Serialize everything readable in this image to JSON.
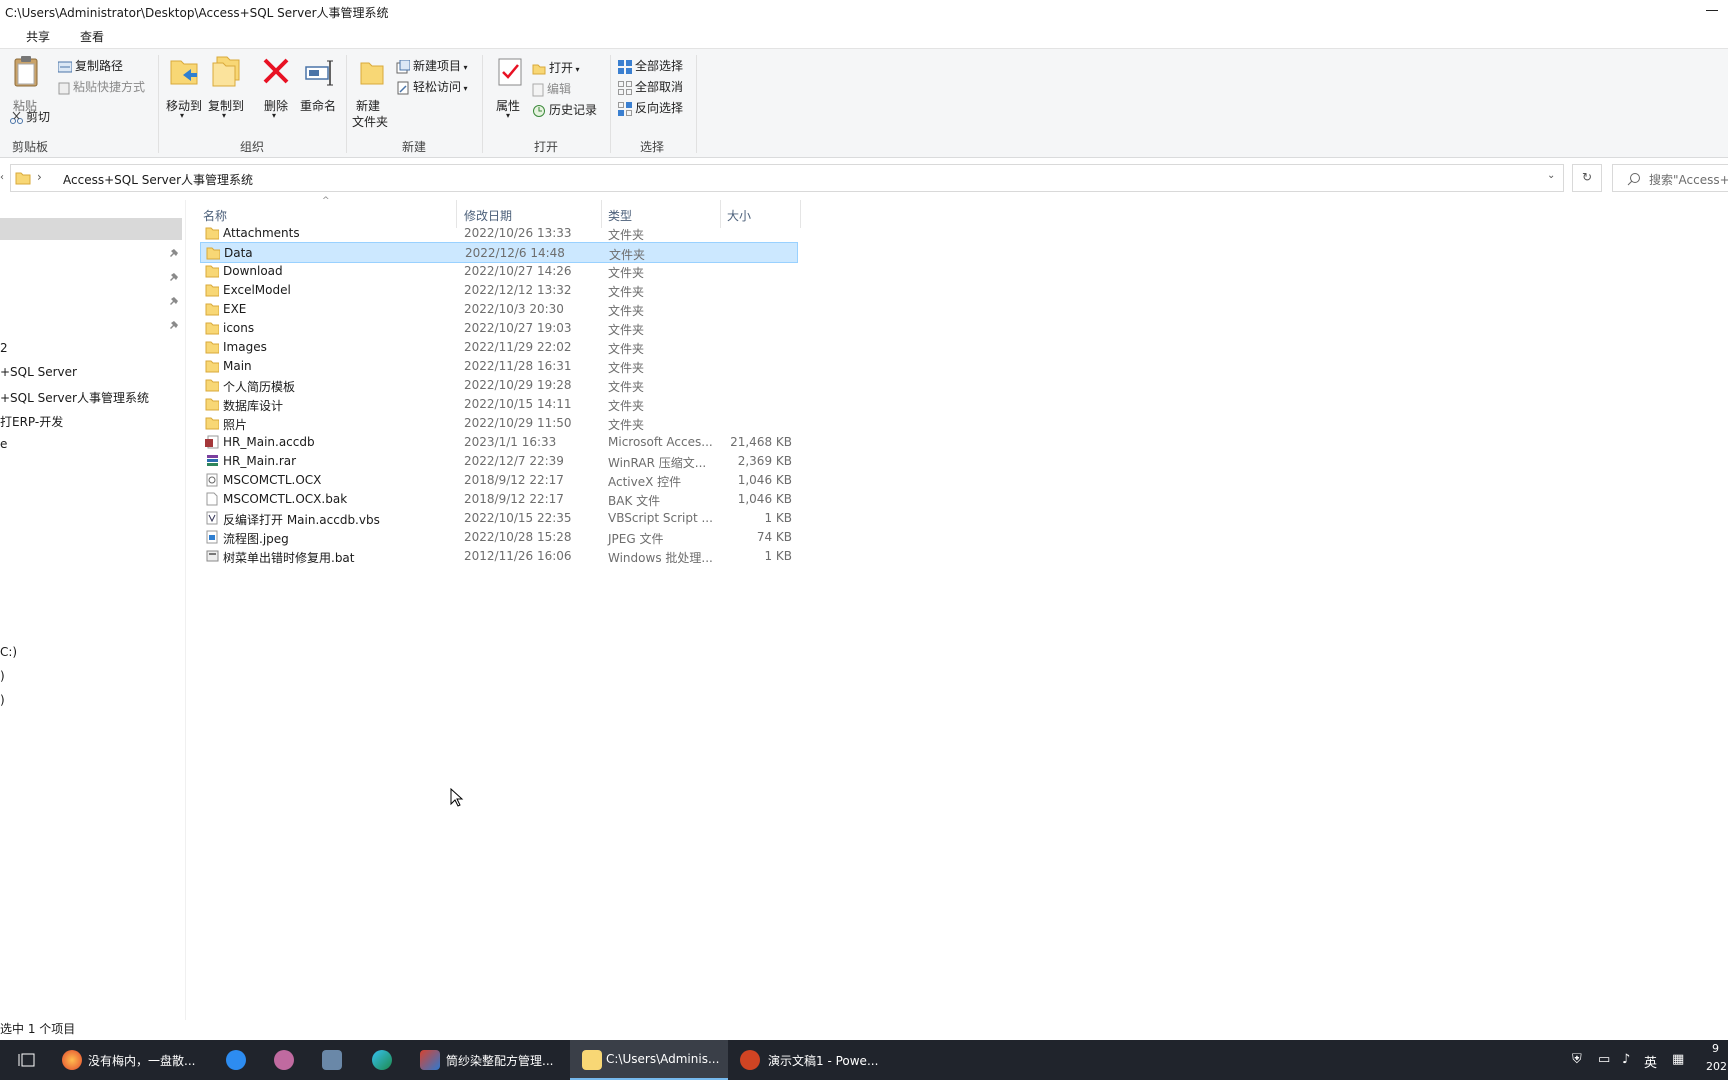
{
  "window": {
    "title": "C:\\Users\\Administrator\\Desktop\\Access+SQL Server人事管理系统"
  },
  "ribbon_tabs": [
    "共享",
    "查看"
  ],
  "ribbon": {
    "clipboard": {
      "paste": "粘贴",
      "copy_path": "复制路径",
      "paste_shortcut": "粘贴快捷方式",
      "cut": "剪切",
      "group": "剪贴板"
    },
    "organize": {
      "move_to": "移动到",
      "copy_to": "复制到",
      "delete": "删除",
      "rename": "重命名",
      "group": "组织"
    },
    "new": {
      "new_item": "新建项目",
      "easy_access": "轻松访问",
      "new_folder_1": "新建",
      "new_folder_2": "文件夹",
      "group": "新建"
    },
    "open": {
      "properties": "属性",
      "open": "打开",
      "edit": "编辑",
      "history": "历史记录",
      "group": "打开"
    },
    "select": {
      "select_all": "全部选择",
      "select_none": "全部取消",
      "invert": "反向选择",
      "group": "选择"
    }
  },
  "address": {
    "path": "Access+SQL Server人事管理系统",
    "search_placeholder": "搜索\"Access+"
  },
  "nav": {
    "items": [
      "2",
      "+SQL Server",
      "+SQL Server人事管理系统",
      "打ERP-开发",
      "e",
      "C:)",
      ")",
      ")"
    ]
  },
  "columns": {
    "name": "名称",
    "date": "修改日期",
    "type": "类型",
    "size": "大小"
  },
  "files": [
    {
      "name": "Attachments",
      "date": "2022/10/26 13:33",
      "type": "文件夹",
      "size": "",
      "icon": "folder-icon"
    },
    {
      "name": "Data",
      "date": "2022/12/6 14:48",
      "type": "文件夹",
      "size": "",
      "icon": "folder-icon"
    },
    {
      "name": "Download",
      "date": "2022/10/27 14:26",
      "type": "文件夹",
      "size": "",
      "icon": "folder-icon"
    },
    {
      "name": "ExcelModel",
      "date": "2022/12/12 13:32",
      "type": "文件夹",
      "size": "",
      "icon": "folder-icon"
    },
    {
      "name": "EXE",
      "date": "2022/10/3 20:30",
      "type": "文件夹",
      "size": "",
      "icon": "folder-icon"
    },
    {
      "name": "icons",
      "date": "2022/10/27 19:03",
      "type": "文件夹",
      "size": "",
      "icon": "folder-icon"
    },
    {
      "name": "Images",
      "date": "2022/11/29 22:02",
      "type": "文件夹",
      "size": "",
      "icon": "folder-icon"
    },
    {
      "name": "Main",
      "date": "2022/11/28 16:31",
      "type": "文件夹",
      "size": "",
      "icon": "folder-icon"
    },
    {
      "name": "个人简历模板",
      "date": "2022/10/29 19:28",
      "type": "文件夹",
      "size": "",
      "icon": "folder-icon"
    },
    {
      "name": "数据库设计",
      "date": "2022/10/15 14:11",
      "type": "文件夹",
      "size": "",
      "icon": "folder-icon"
    },
    {
      "name": "照片",
      "date": "2022/10/29 11:50",
      "type": "文件夹",
      "size": "",
      "icon": "folder-icon"
    },
    {
      "name": "HR_Main.accdb",
      "date": "2023/1/1 16:33",
      "type": "Microsoft Acces...",
      "size": "21,468 KB",
      "icon": "access-file-icon"
    },
    {
      "name": "HR_Main.rar",
      "date": "2022/12/7 22:39",
      "type": "WinRAR 压缩文...",
      "size": "2,369 KB",
      "icon": "rar-file-icon"
    },
    {
      "name": "MSCOMCTL.OCX",
      "date": "2018/9/12 22:17",
      "type": "ActiveX 控件",
      "size": "1,046 KB",
      "icon": "ocx-file-icon"
    },
    {
      "name": "MSCOMCTL.OCX.bak",
      "date": "2018/9/12 22:17",
      "type": "BAK 文件",
      "size": "1,046 KB",
      "icon": "blank-file-icon"
    },
    {
      "name": "反编译打开 Main.accdb.vbs",
      "date": "2022/10/15 22:35",
      "type": "VBScript Script ...",
      "size": "1 KB",
      "icon": "vbs-file-icon"
    },
    {
      "name": "流程图.jpeg",
      "date": "2022/10/28 15:28",
      "type": "JPEG 文件",
      "size": "74 KB",
      "icon": "image-file-icon"
    },
    {
      "name": "树菜单出错时修复用.bat",
      "date": "2012/11/26 16:06",
      "type": "Windows 批处理...",
      "size": "1 KB",
      "icon": "bat-file-icon"
    }
  ],
  "status": {
    "text": "选中 1 个项目"
  },
  "taskbar": {
    "apps": [
      {
        "label": "没有梅内，一盘散...",
        "icon": "firefox-icon"
      },
      {
        "label": "",
        "icon": "translate-icon"
      },
      {
        "label": "",
        "icon": "paint-icon"
      },
      {
        "label": "",
        "icon": "tools-icon"
      },
      {
        "label": "",
        "icon": "edge-icon"
      },
      {
        "label": "筒纱染整配方管理...",
        "icon": "app-icon"
      },
      {
        "label": "C:\\Users\\Adminis...",
        "icon": "explorer-icon"
      },
      {
        "label": "演示文稿1 - Powe...",
        "icon": "powerpoint-icon"
      }
    ],
    "ime": "英",
    "clock_fragment_1": "9",
    "clock_fragment_2": "202"
  },
  "colors": {
    "selection_bg": "#cce8ff",
    "selection_border": "#99d1ff",
    "folder": "#f8d775",
    "taskbar": "#20242c",
    "nav_selected": "#d9d9d9"
  }
}
